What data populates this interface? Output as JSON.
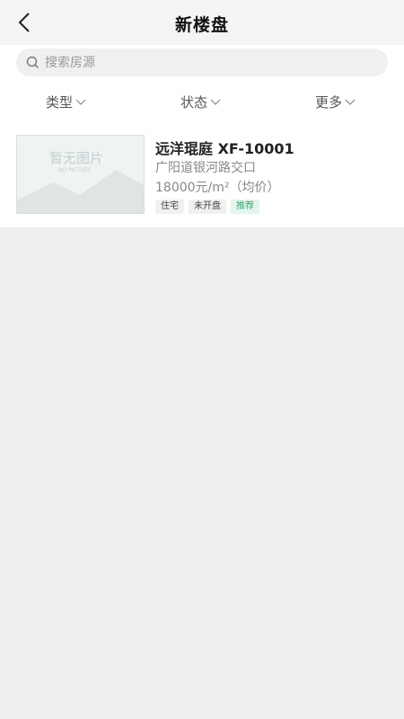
{
  "header": {
    "title": "新楼盘",
    "back_icon": "chevron-left-icon"
  },
  "search": {
    "placeholder": "搜索房源",
    "value": "",
    "icon": "search-icon"
  },
  "filters": [
    {
      "label": "类型",
      "icon": "chevron-down-icon"
    },
    {
      "label": "状态",
      "icon": "chevron-down-icon"
    },
    {
      "label": "更多",
      "icon": "chevron-down-icon"
    }
  ],
  "listings": [
    {
      "name": "远洋琨庭 XF-10001",
      "address": "广阳道银河路交口",
      "price": "18000元/m²（均价）",
      "image_placeholder": "暂无图片",
      "image_placeholder_sub": "NO PICTURE",
      "tags": [
        "住宅",
        "未开盘",
        "推荐"
      ]
    }
  ],
  "colors": {
    "background": "#efefef",
    "recommend_tag": "#3aaa6e"
  }
}
